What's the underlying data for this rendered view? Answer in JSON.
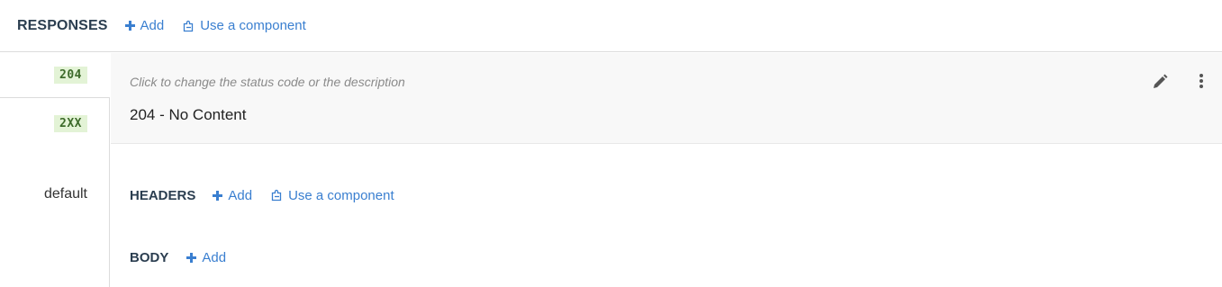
{
  "responses": {
    "title": "RESPONSES",
    "add_label": "Add",
    "component_label": "Use a component"
  },
  "status_list": [
    {
      "code": "204",
      "kind": "badge",
      "selected": true
    },
    {
      "code": "2XX",
      "kind": "badge",
      "selected": false
    },
    {
      "code": "default",
      "kind": "text",
      "selected": false
    }
  ],
  "detail": {
    "hint": "Click to change the status code or the description",
    "title": "204 - No Content"
  },
  "headers_section": {
    "title": "HEADERS",
    "add_label": "Add",
    "component_label": "Use a component"
  },
  "body_section": {
    "title": "BODY",
    "add_label": "Add"
  },
  "colors": {
    "accent": "#3a7fd0",
    "title": "#2b3e50",
    "badge_bg": "#e3f3d6",
    "badge_fg": "#3d6b2a",
    "panel_bg": "#f8f8f8"
  },
  "icons": {
    "add": "plus-icon",
    "component": "puzzle-icon",
    "edit": "pencil-icon",
    "more": "more-vertical-icon"
  }
}
